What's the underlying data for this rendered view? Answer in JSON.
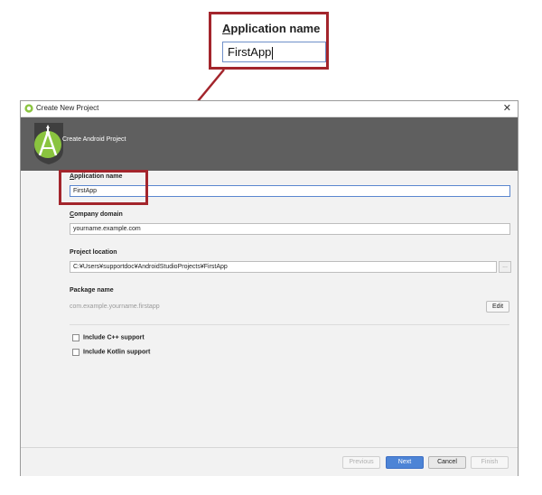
{
  "callout": {
    "label_mnemonic": "A",
    "label_rest": "pplication name",
    "input_value": "FirstApp"
  },
  "window": {
    "title": "Create New Project",
    "close_glyph": "✕",
    "banner_title": "Create Android Project"
  },
  "form": {
    "app_name": {
      "label_mnemonic": "A",
      "label_rest": "pplication name",
      "value": "FirstApp"
    },
    "company_domain": {
      "label_mnemonic": "C",
      "label_rest": "ompany domain",
      "value": "yourname.example.com"
    },
    "project_location": {
      "label": "Project location",
      "value": "C:¥Users¥supportdoc¥AndroidStudioProjects¥FirstApp",
      "browse_label": "..."
    },
    "package_name": {
      "label": "Package name",
      "value": "com.example.yourname.firstapp",
      "edit_label": "Edit"
    },
    "include_cpp": {
      "label": "Include C++ support",
      "checked": false
    },
    "include_kotlin": {
      "label": "Include Kotlin support",
      "checked": false
    }
  },
  "footer": {
    "previous": "Previous",
    "next": "Next",
    "cancel": "Cancel",
    "finish": "Finish"
  },
  "colors": {
    "highlight": "#a3252c",
    "banner": "#5f5f5f",
    "primary_button": "#4d84d6",
    "focus_border": "#5a86cf",
    "android_green": "#8ac43f"
  }
}
